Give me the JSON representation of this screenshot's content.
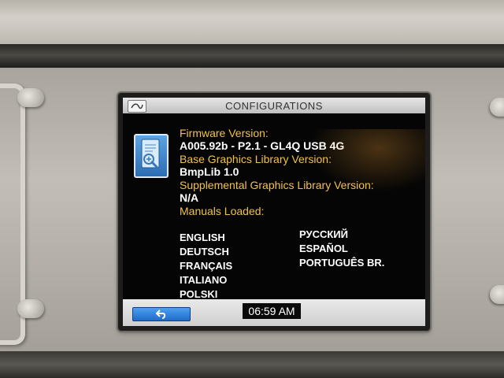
{
  "screen": {
    "title": "CONFIGURATIONS",
    "firmware": {
      "label": "Firmware Version:",
      "value": "A005.92b - P2.1 - GL4Q USB 4G"
    },
    "base_graphics": {
      "label": "Base Graphics Library Version:",
      "value": "BmpLib 1.0"
    },
    "supplemental_graphics": {
      "label": "Supplemental Graphics Library Version:",
      "value": "N/A"
    },
    "manuals": {
      "label": "Manuals Loaded:",
      "languages": [
        "ENGLISH",
        "DEUTSCH",
        "FRANÇAIS",
        "ITALIANO",
        "POLSKI",
        "РУССКИЙ",
        "ESPAÑOL",
        "PORTUGUÊS BR."
      ]
    },
    "time": "06:59 AM"
  },
  "icons": {
    "logo": "brand-logo-icon",
    "config": "configuration-document-icon",
    "back": "back-arrow-icon"
  },
  "colors": {
    "label": "#f2c248",
    "value": "#ffffff",
    "background": "#050505",
    "back_button": "#2a7ad6"
  }
}
